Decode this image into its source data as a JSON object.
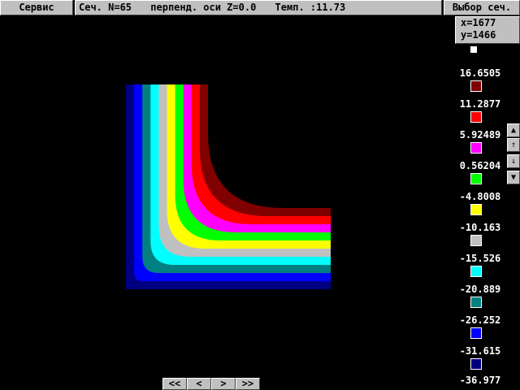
{
  "menubar": {
    "service_label": "Сервис",
    "section_number": "Сеч. N=65",
    "section_plane": "перпенд. оси Z=0.0",
    "temperature": "Темп. :11.73",
    "select_section_label": "Выбор сеч."
  },
  "cursor": {
    "x_label": "x=1677",
    "y_label": "y=1466"
  },
  "legend": {
    "levels": [
      {
        "value": "16.6505",
        "color": "#800000"
      },
      {
        "value": "11.2877",
        "color": "#ff0000"
      },
      {
        "value": "5.92489",
        "color": "#ff00ff"
      },
      {
        "value": "0.56204",
        "color": "#00ff00"
      },
      {
        "value": "-4.8008",
        "color": "#ffff00"
      },
      {
        "value": "-10.163",
        "color": "#c0c0c0"
      },
      {
        "value": "-15.526",
        "color": "#00ffff"
      },
      {
        "value": "-20.889",
        "color": "#008080"
      },
      {
        "value": "-26.252",
        "color": "#0000ff"
      },
      {
        "value": "-31.615",
        "color": "#000080"
      },
      {
        "value": "-36.977",
        "color": ""
      }
    ]
  },
  "scroll": {
    "page_up": "▲",
    "up": "↑",
    "down": "↓",
    "page_down": "▼"
  },
  "nav": {
    "first": "<<",
    "prev": "<",
    "next": ">",
    "last": ">>"
  },
  "contour_colors": [
    "#000080",
    "#0000ff",
    "#008080",
    "#00ffff",
    "#c0c0c0",
    "#ffff00",
    "#00ff00",
    "#ff00ff",
    "#ff0000",
    "#800000"
  ]
}
